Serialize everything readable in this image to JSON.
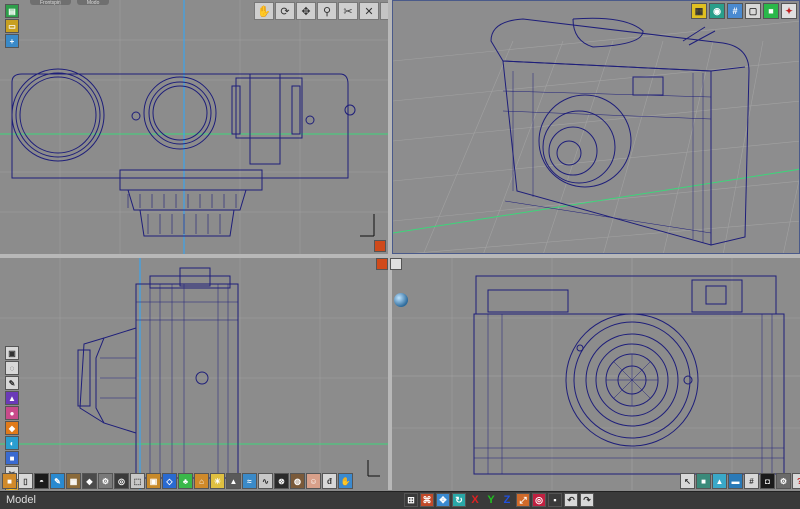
{
  "status": {
    "mode_label": "Model"
  },
  "tabs": [
    "Frontspin",
    "Modo"
  ],
  "axis_labels": [
    "X",
    "Y",
    "Z"
  ],
  "viewports": [
    {
      "id": "top",
      "name": "top-orthographic-view"
    },
    {
      "id": "perspective",
      "name": "perspective-view"
    },
    {
      "id": "right",
      "name": "right-orthographic-view"
    },
    {
      "id": "front",
      "name": "front-orthographic-view"
    }
  ],
  "top_toolbar_icons": [
    "hand-icon",
    "orbit-icon",
    "pan-icon",
    "zoom-icon",
    "fit-icon",
    "close-axis-icon",
    "up-arrow-icon",
    "down-arrow-icon"
  ],
  "top_toolbar_glyphs": [
    "✋",
    "⟳",
    "✥",
    "⚲",
    "✂",
    "✕",
    "↑",
    "↓"
  ],
  "persp_toolbar_icons": [
    "layout-icon",
    "camera-icon",
    "grid-icon",
    "window-icon",
    "shade-icon",
    "light-icon"
  ],
  "colors": {
    "wire": "#1e1e7a",
    "grid": "#a8a8a8",
    "axis_green": "#3cd67a",
    "viewport_bg": "#8c8c8c"
  }
}
